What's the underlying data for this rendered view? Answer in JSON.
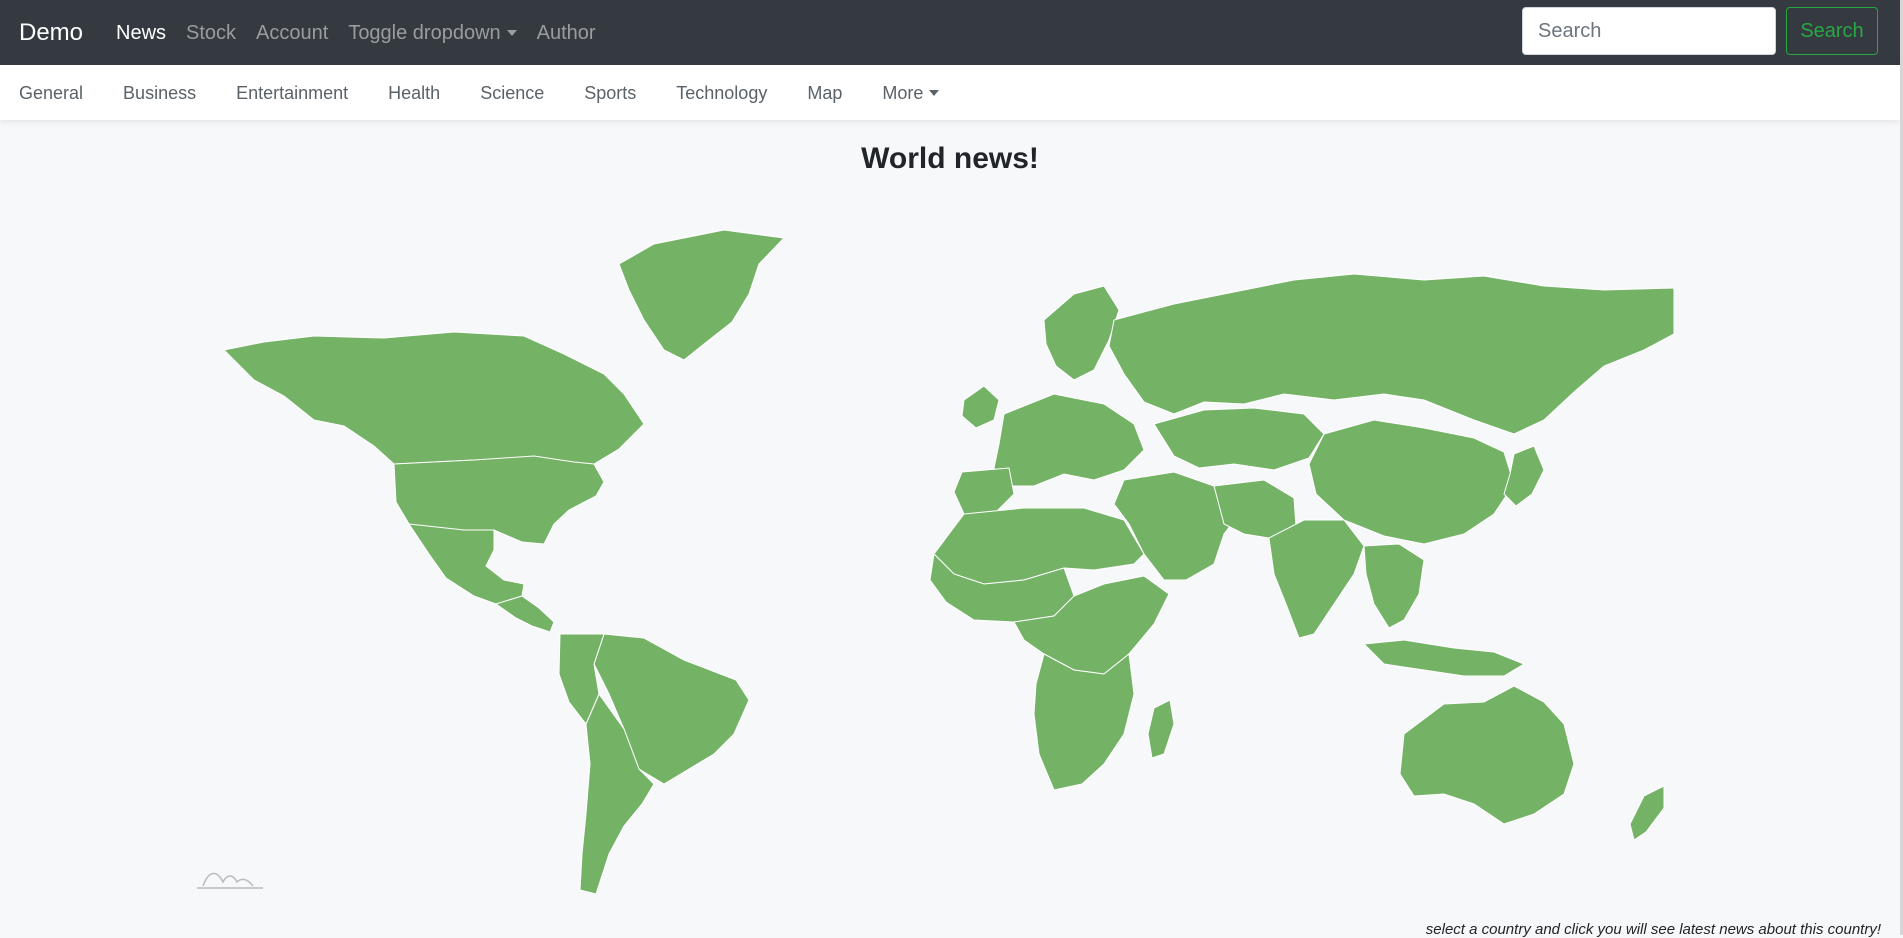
{
  "navbar": {
    "brand": "Demo",
    "links": [
      {
        "label": "News",
        "active": true
      },
      {
        "label": "Stock",
        "active": false
      },
      {
        "label": "Account",
        "active": false
      },
      {
        "label": "Toggle dropdown",
        "active": false,
        "dropdown": true
      },
      {
        "label": "Author",
        "active": false
      }
    ],
    "search": {
      "placeholder": "Search",
      "value": "",
      "button_label": "Search"
    }
  },
  "categories": {
    "items": [
      "General",
      "Business",
      "Entertainment",
      "Health",
      "Science",
      "Sports",
      "Technology",
      "Map"
    ],
    "more_label": "More"
  },
  "main": {
    "title": "World news!",
    "hint": "select a country and click you will see latest news about this country!"
  },
  "colors": {
    "navbar_bg": "#343a40",
    "land": "#74b266",
    "search_accent": "#28a745",
    "page_bg": "#f7f8fa"
  }
}
